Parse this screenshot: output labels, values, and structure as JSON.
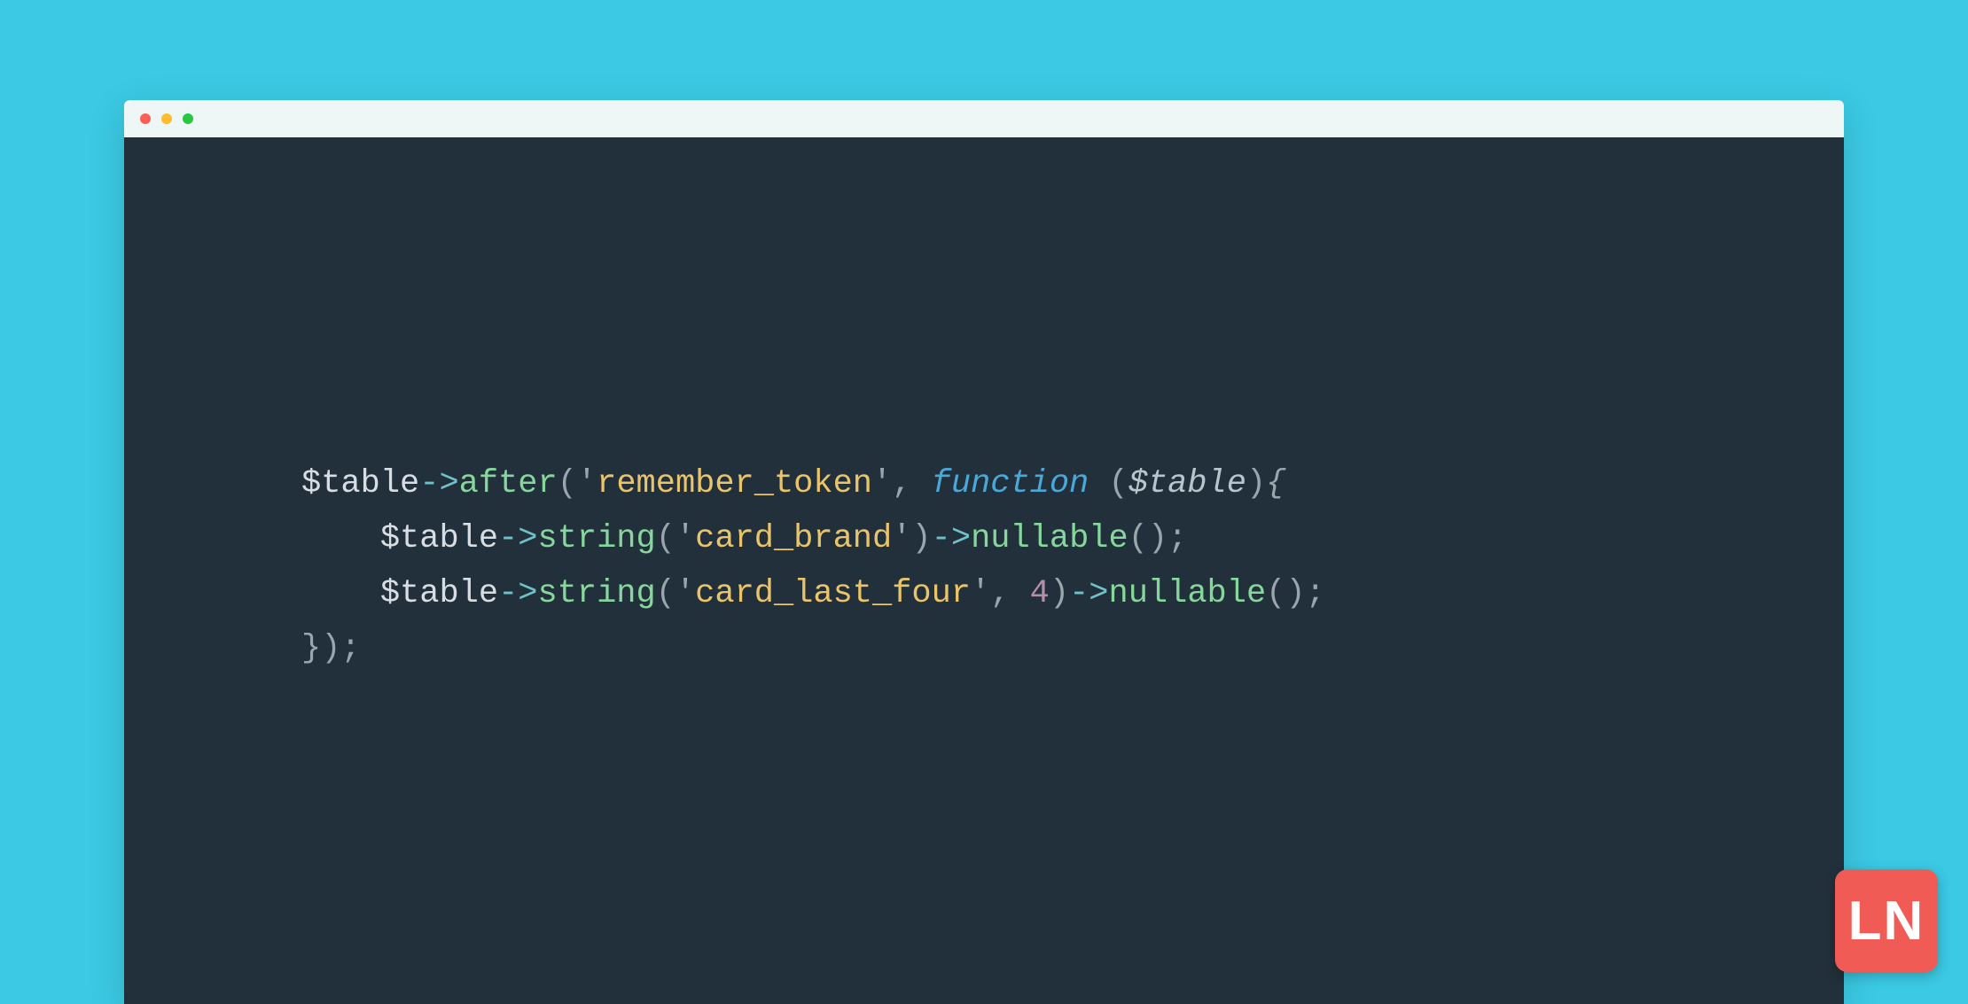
{
  "code": {
    "line1": {
      "var": "$table",
      "arrow": "->",
      "method": "after",
      "lparen": "(",
      "q1": "'",
      "str": "remember_token",
      "q2": "'",
      "comma": ", ",
      "keyword": "function ",
      "lparen2": "(",
      "param": "$table",
      "rparen2": ")",
      "brace": "{"
    },
    "line2": {
      "indent": "    ",
      "var": "$table",
      "arrow1": "->",
      "method1": "string",
      "lparen": "(",
      "q1": "'",
      "str": "card_brand",
      "q2": "'",
      "rparen": ")",
      "arrow2": "->",
      "method2": "nullable",
      "parens": "()",
      "semi": ";"
    },
    "line3": {
      "indent": "    ",
      "var": "$table",
      "arrow1": "->",
      "method1": "string",
      "lparen": "(",
      "q1": "'",
      "str": "card_last_four",
      "q2": "'",
      "comma": ", ",
      "num": "4",
      "rparen": ")",
      "arrow2": "->",
      "method2": "nullable",
      "parens": "()",
      "semi": ";"
    },
    "line4": {
      "close": "});"
    }
  },
  "logo": {
    "text": "LN"
  }
}
